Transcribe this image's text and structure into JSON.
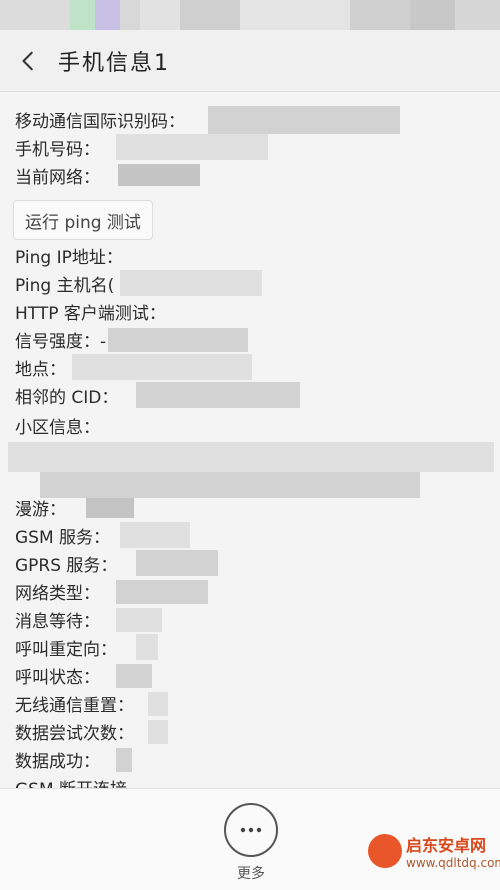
{
  "header": {
    "title": "手机信息1",
    "back_icon": "chevron-left-icon"
  },
  "info_rows": [
    {
      "key": "imei",
      "label": "移动通信国际识别码："
    },
    {
      "key": "phone",
      "label": "手机号码："
    },
    {
      "key": "network",
      "label": "当前网络："
    }
  ],
  "ping_button": {
    "label": "运行 ping 测试"
  },
  "detail_rows": [
    {
      "key": "ping_ip",
      "label": "Ping IP地址："
    },
    {
      "key": "ping_host",
      "label": "Ping 主机名("
    },
    {
      "key": "http",
      "label": "HTTP 客户端测试："
    },
    {
      "key": "signal",
      "label": "信号强度：-"
    },
    {
      "key": "location",
      "label": "地点："
    },
    {
      "key": "cid",
      "label": "相邻的 CID："
    },
    {
      "key": "cell",
      "label": "小区信息："
    },
    {
      "key": "roaming",
      "label": "漫游："
    },
    {
      "key": "gsm",
      "label": "GSM 服务："
    },
    {
      "key": "gprs",
      "label": "GPRS 服务："
    },
    {
      "key": "net_type",
      "label": "网络类型："
    },
    {
      "key": "msg_wait",
      "label": "消息等待："
    },
    {
      "key": "call_redirect",
      "label": "呼叫重定向："
    },
    {
      "key": "call_state",
      "label": "呼叫状态："
    },
    {
      "key": "radio_reset",
      "label": "无线通信重置："
    },
    {
      "key": "data_retry",
      "label": "数据尝试次数："
    },
    {
      "key": "data_success",
      "label": "数据成功："
    },
    {
      "key": "gsm_disconnect",
      "label": "GSM 断开连接"
    }
  ],
  "bottom": {
    "more_label": "更多",
    "more_icon": "more-dots-icon"
  },
  "watermark": {
    "title": "启东安卓网",
    "url": "www.qdltdq.com"
  },
  "colors": {
    "background": "#f4f4f4",
    "text": "#2b2b2b",
    "redaction": "#d2d2d2",
    "watermark": "#d9481c"
  }
}
